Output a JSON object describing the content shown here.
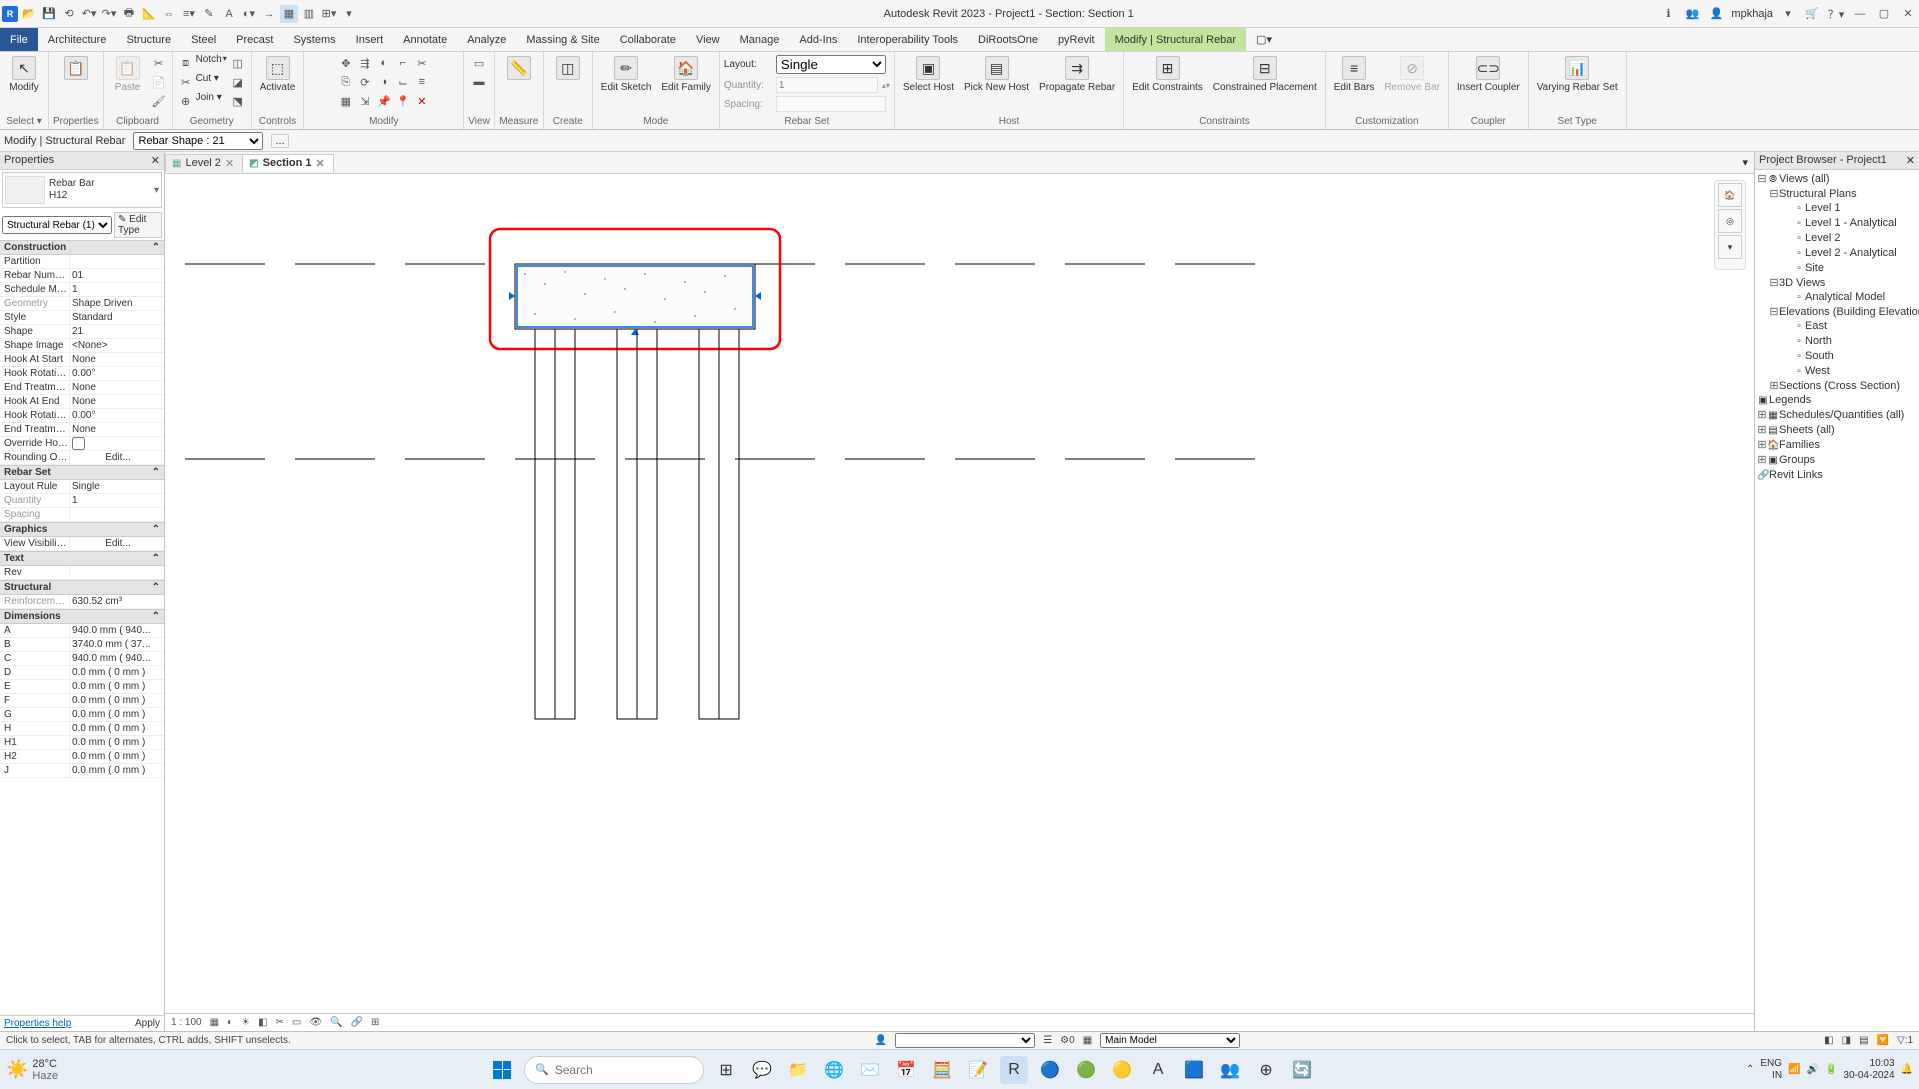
{
  "title": "Autodesk Revit 2023 - Project1 - Section: Section 1",
  "user": "mpkhaja",
  "menu": {
    "file": "File",
    "tabs": [
      "Architecture",
      "Structure",
      "Steel",
      "Precast",
      "Systems",
      "Insert",
      "Annotate",
      "Analyze",
      "Massing & Site",
      "Collaborate",
      "View",
      "Manage",
      "Add-Ins",
      "Interoperability Tools",
      "DiRootsOne",
      "pyRevit",
      "Modify | Structural Rebar"
    ]
  },
  "ribbon": {
    "select": "Select ▾",
    "properties": "Properties",
    "modify": "Modify",
    "clipboard": "Clipboard",
    "paste": "Paste",
    "notch": "Notch",
    "cut": "Cut ▾",
    "join": "Join ▾",
    "geometry": "Geometry",
    "activate": "Activate",
    "controls": "Controls",
    "modify_grp": "Modify",
    "view": "View",
    "measure": "Measure",
    "create": "Create",
    "edit_sketch": "Edit Sketch",
    "edit_family": "Edit Family",
    "mode": "Mode",
    "layout_lbl": "Layout:",
    "layout_val": "Single",
    "quantity_lbl": "Quantity:",
    "quantity_val": "1",
    "spacing_lbl": "Spacing:",
    "rebar_set": "Rebar Set",
    "select_host": "Select Host",
    "pick_new_host": "Pick New Host",
    "propagate_rebar": "Propagate Rebar",
    "host": "Host",
    "edit_constraints": "Edit Constraints",
    "constrained_placement": "Constrained Placement",
    "constraints": "Constraints",
    "edit_bars": "Edit Bars",
    "remove_bar": "Remove Bar",
    "customization": "Customization",
    "insert_coupler": "Insert Coupler",
    "coupler": "Coupler",
    "varying_rebar": "Varying Rebar Set",
    "set_type": "Set Type"
  },
  "optbar": {
    "context": "Modify | Structural Rebar",
    "shape_lbl": "Rebar Shape : 21"
  },
  "props": {
    "title": "Properties",
    "type_name": "Rebar Bar",
    "type_size": "H12",
    "instance": "Structural Rebar (1)",
    "edit_type": "Edit Type",
    "cat_construction": "Construction",
    "partition_k": "Partition",
    "partition_v": "",
    "rebar_num_k": "Rebar Number",
    "rebar_num_v": "01",
    "sched_mark_k": "Schedule Mark",
    "sched_mark_v": "1",
    "geometry_k": "Geometry",
    "geometry_v": "Shape Driven",
    "style_k": "Style",
    "style_v": "Standard",
    "shape_k": "Shape",
    "shape_v": "21",
    "shape_img_k": "Shape Image",
    "shape_img_v": "<None>",
    "hook_start_k": "Hook At Start",
    "hook_start_v": "None",
    "hook_rot1_k": "Hook Rotatio...",
    "hook_rot1_v": "0.00°",
    "end_treat1_k": "End Treatmen...",
    "end_treat1_v": "None",
    "hook_end_k": "Hook At End",
    "hook_end_v": "None",
    "hook_rot2_k": "Hook Rotatio...",
    "hook_rot2_v": "0.00°",
    "end_treat2_k": "End Treatmen...",
    "end_treat2_v": "None",
    "override_k": "Override Hoo...",
    "rounding_k": "Rounding Ov...",
    "edit_btn": "Edit...",
    "cat_rebarset": "Rebar Set",
    "layout_k": "Layout Rule",
    "layout_v": "Single",
    "qty_k": "Quantity",
    "qty_v": "1",
    "spacing_k": "Spacing",
    "spacing_v": "",
    "cat_graphics": "Graphics",
    "viewvis_k": "View Visibility ...",
    "cat_text": "Text",
    "rev_k": "Rev",
    "rev_v": "",
    "cat_structural": "Structural",
    "reinf_k": "Reinforcemen...",
    "reinf_v": "630.52 cm³",
    "cat_dims": "Dimensions",
    "A_v": "940.0 mm ( 940...",
    "B_v": "3740.0 mm ( 37...",
    "C_v": "940.0 mm ( 940...",
    "D_v": "0.0 mm ( 0 mm )",
    "E_v": "0.0 mm ( 0 mm )",
    "F_v": "0.0 mm ( 0 mm )",
    "G_v": "0.0 mm ( 0 mm )",
    "H_v": "0.0 mm ( 0 mm )",
    "H1_v": "0.0 mm ( 0 mm )",
    "H2_v": "0.0 mm ( 0 mm )",
    "J_v": "0.0 mm ( 0 mm )",
    "help": "Properties help",
    "apply": "Apply"
  },
  "viewtabs": {
    "level2": "Level 2",
    "section1": "Section 1"
  },
  "viewctrl": {
    "scale": "1 : 100"
  },
  "browser": {
    "title": "Project Browser - Project1",
    "views_all": "Views (all)",
    "struct_plans": "Structural Plans",
    "level1": "Level 1",
    "level1a": "Level 1 - Analytical",
    "level2": "Level 2",
    "level2a": "Level 2 - Analytical",
    "site": "Site",
    "views3d": "3D Views",
    "analytical": "Analytical Model",
    "elevations": "Elevations (Building Elevation",
    "east": "East",
    "north": "North",
    "south": "South",
    "west": "West",
    "sections": "Sections (Cross Section)",
    "legends": "Legends",
    "schedules": "Schedules/Quantities (all)",
    "sheets": "Sheets (all)",
    "families": "Families",
    "groups": "Groups",
    "revitlinks": "Revit Links"
  },
  "status": {
    "hint": "Click to select, TAB for alternates, CTRL adds, SHIFT unselects.",
    "main_model": "Main Model"
  },
  "taskbar": {
    "temp": "28°C",
    "cond": "Haze",
    "search_ph": "Search",
    "lang1": "ENG",
    "lang2": "IN",
    "time": "10:03",
    "date": "30-04-2024"
  }
}
